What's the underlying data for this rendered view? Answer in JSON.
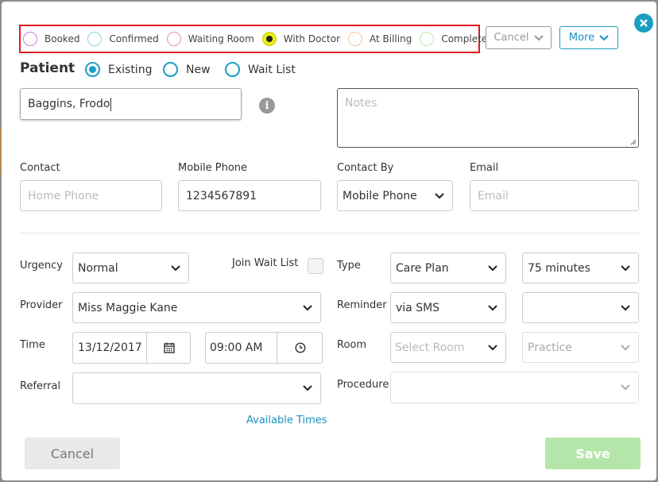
{
  "status_bar": {
    "items": [
      {
        "label": "Booked",
        "color": "#c87ee0",
        "active": false
      },
      {
        "label": "Confirmed",
        "color": "#7fd6e3",
        "active": false
      },
      {
        "label": "Waiting Room",
        "color": "#ea8fb3",
        "active": false
      },
      {
        "label": "With Doctor",
        "color": "#e8ef14",
        "active": true
      },
      {
        "label": "At Billing",
        "color": "#f3c497",
        "active": false
      },
      {
        "label": "Completed",
        "color": "#b9ec9f",
        "active": false
      }
    ],
    "cancel_label": "Cancel",
    "more_label": "More"
  },
  "patient": {
    "title": "Patient",
    "options": [
      "Existing",
      "New",
      "Wait List"
    ],
    "selected": "Existing",
    "name_value": "Baggins, Frodo",
    "notes_placeholder": "Notes"
  },
  "contact": {
    "contact_label": "Contact",
    "home_phone_placeholder": "Home Phone",
    "mobile_label": "Mobile Phone",
    "mobile_value": "1234567891",
    "contact_by_label": "Contact By",
    "contact_by_value": "Mobile Phone",
    "email_label": "Email",
    "email_placeholder": "Email"
  },
  "appointment": {
    "urgency_label": "Urgency",
    "urgency_value": "Normal",
    "join_wait_list_label": "Join Wait List",
    "type_label": "Type",
    "type_value": "Care Plan",
    "duration_value": "75 minutes",
    "provider_label": "Provider",
    "provider_value": "Miss Maggie Kane",
    "reminder_label": "Reminder",
    "reminder_value": "via SMS",
    "reminder_extra_value": "",
    "time_label": "Time",
    "date_value": "13/12/2017",
    "time_value": "09:00 AM",
    "room_label": "Room",
    "room_placeholder": "Select Room",
    "practice_placeholder": "Practice",
    "referral_label": "Referral",
    "referral_value": "",
    "procedure_label": "Procedure",
    "procedure_value": "",
    "available_times_label": "Available Times"
  },
  "footer": {
    "cancel_label": "Cancel",
    "save_label": "Save"
  },
  "colors": {
    "accent": "#1a9fc1",
    "highlight_border": "#e0171d",
    "save_disabled": "#b5e6a9"
  }
}
